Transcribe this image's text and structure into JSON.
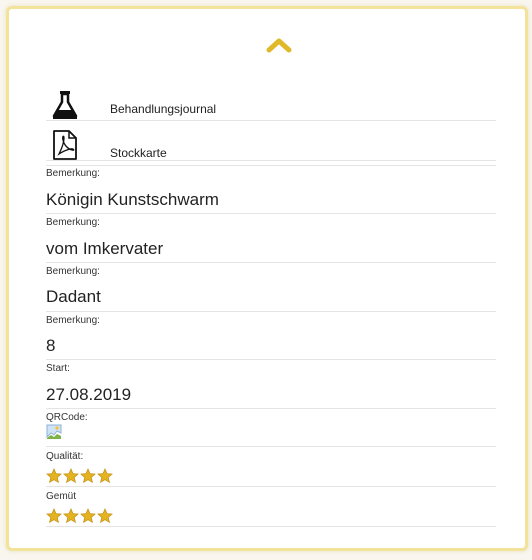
{
  "links": [
    {
      "label": "Behandlungsjournal",
      "icon": "flask-icon"
    },
    {
      "label": "Stockkarte",
      "icon": "pdf-document-icon"
    }
  ],
  "fields": [
    {
      "label": "Bemerkung:",
      "value": "Königin Kunstschwarm"
    },
    {
      "label": "Bemerkung:",
      "value": "vom Imkervater"
    },
    {
      "label": "Bemerkung:",
      "value": "Dadant"
    },
    {
      "label": "Bemerkung:",
      "value": "8"
    },
    {
      "label": "Start:",
      "value": "27.08.2019"
    }
  ],
  "qrcode": {
    "label": "QRCode:",
    "image": "broken-image-icon"
  },
  "ratings": [
    {
      "label": "Qualität:",
      "stars": 4
    },
    {
      "label": "Gemüt",
      "stars": 4
    }
  ],
  "colors": {
    "accent": "#e0b92b",
    "star": "#e3b320",
    "border": "#f2e29a"
  }
}
